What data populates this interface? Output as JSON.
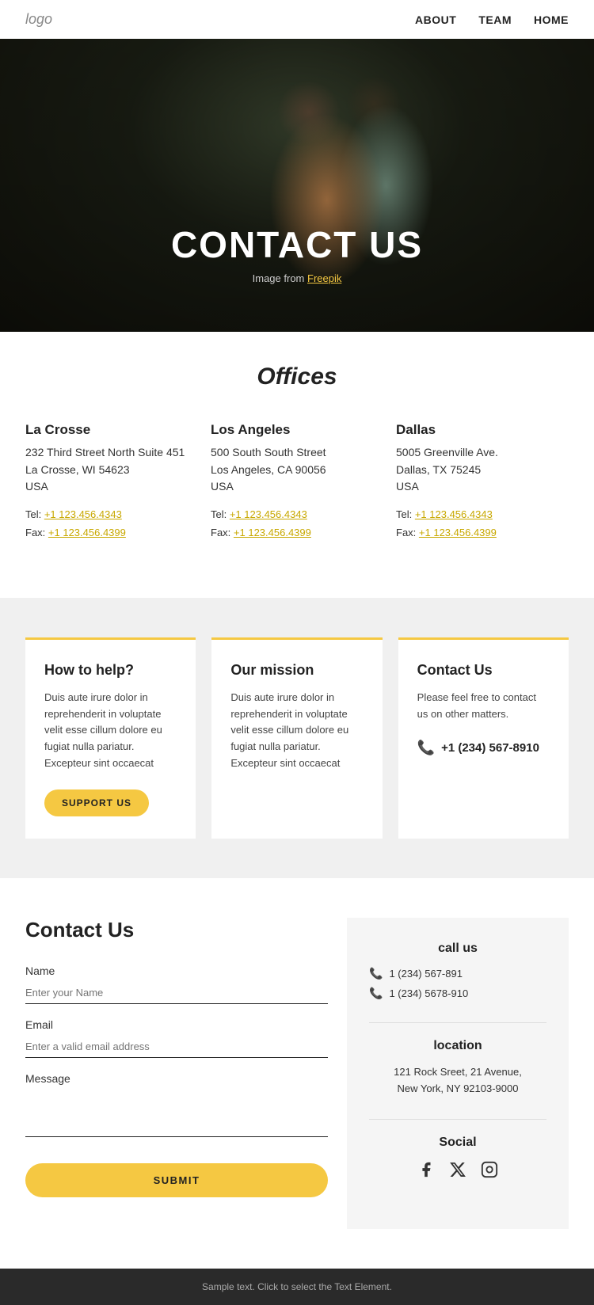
{
  "navbar": {
    "logo": "logo",
    "links": [
      {
        "label": "ABOUT",
        "href": "#"
      },
      {
        "label": "TEAM",
        "href": "#"
      },
      {
        "label": "HOME",
        "href": "#"
      }
    ]
  },
  "hero": {
    "title": "CONTACT US",
    "image_credit_text": "Image from ",
    "image_credit_link": "Freepik"
  },
  "offices": {
    "section_title": "Offices",
    "list": [
      {
        "city": "La Crosse",
        "address": "232 Third Street North Suite 451\nLa Crosse, WI 54623\nUSA",
        "tel": "+1 123.456.4343",
        "fax": "+1 123.456.4399"
      },
      {
        "city": "Los Angeles",
        "address": "500 South South Street\nLos Angeles, CA 90056\nUSA",
        "tel": "+1 123.456.4343",
        "fax": "+1 123.456.4399"
      },
      {
        "city": "Dallas",
        "address": "5005 Greenville Ave.\nDallas, TX 75245\nUSA",
        "tel": "+1 123.456.4343",
        "fax": "+1 123.456.4399"
      }
    ]
  },
  "info_cards": [
    {
      "id": "how-to-help",
      "title": "How to help?",
      "body": "Duis aute irure dolor in reprehenderit in voluptate velit esse cillum dolore eu fugiat nulla pariatur. Excepteur sint occaecat",
      "button": "SUPPORT US"
    },
    {
      "id": "our-mission",
      "title": "Our mission",
      "body": "Duis aute irure dolor in reprehenderit in voluptate velit esse cillum dolore eu fugiat nulla pariatur. Excepteur sint occaecat",
      "button": null
    },
    {
      "id": "contact-us-card",
      "title": "Contact Us",
      "body": "Please feel free to contact us on other matters.",
      "phone": "+1 (234) 567-8910",
      "button": null
    }
  ],
  "contact_form": {
    "title": "Contact Us",
    "fields": {
      "name_label": "Name",
      "name_placeholder": "Enter your Name",
      "email_label": "Email",
      "email_placeholder": "Enter a valid email address",
      "message_label": "Message"
    },
    "submit_label": "SUBMIT"
  },
  "contact_sidebar": {
    "call_us_title": "call us",
    "phones": [
      "1 (234) 567-891",
      "1 (234) 5678-910"
    ],
    "location_title": "location",
    "address_line1": "121 Rock Sreet, 21 Avenue,",
    "address_line2": "New York, NY 92103-9000",
    "social_title": "Social",
    "social_icons": [
      "facebook",
      "x-twitter",
      "instagram"
    ]
  },
  "footer": {
    "text": "Sample text. Click to select the Text Element."
  }
}
